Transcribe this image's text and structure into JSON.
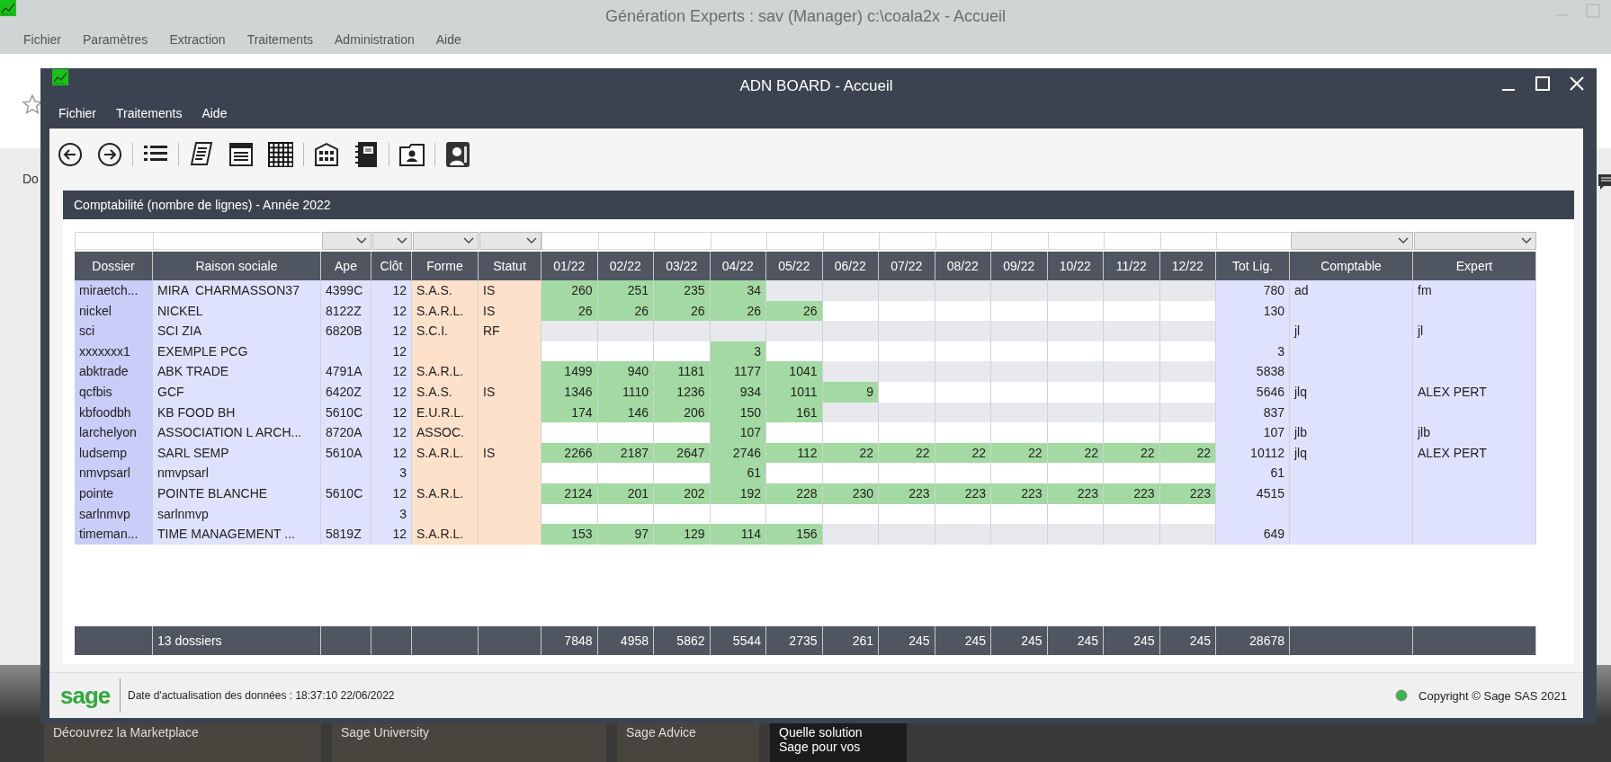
{
  "outer_window": {
    "title": "Génération Experts : sav (Manager) c:\\coala2x - Accueil",
    "menu": [
      "Fichier",
      "Paramètres",
      "Extraction",
      "Traitements",
      "Administration",
      "Aide"
    ],
    "side_label": "Do"
  },
  "window": {
    "title": "ADN BOARD - Accueil",
    "menu": [
      "Fichier",
      "Traitements",
      "Aide"
    ]
  },
  "panel": {
    "title": "Comptabilité (nombre de lignes) - Année 2022"
  },
  "table": {
    "columns": [
      {
        "label": "Dossier",
        "kind": "key",
        "filter": false
      },
      {
        "label": "Raison sociale",
        "kind": "text",
        "filter": false
      },
      {
        "label": "Ape",
        "kind": "text",
        "filter": true
      },
      {
        "label": "Clôt",
        "kind": "number",
        "filter": true
      },
      {
        "label": "Forme",
        "kind": "legal",
        "filter": true
      },
      {
        "label": "Statut",
        "kind": "legal",
        "filter": true
      },
      {
        "label": "01/22",
        "kind": "month",
        "filter": false
      },
      {
        "label": "02/22",
        "kind": "month",
        "filter": false
      },
      {
        "label": "03/22",
        "kind": "month",
        "filter": false
      },
      {
        "label": "04/22",
        "kind": "month",
        "filter": false
      },
      {
        "label": "05/22",
        "kind": "month",
        "filter": false
      },
      {
        "label": "06/22",
        "kind": "month",
        "filter": false
      },
      {
        "label": "07/22",
        "kind": "month",
        "filter": false
      },
      {
        "label": "08/22",
        "kind": "month",
        "filter": false
      },
      {
        "label": "09/22",
        "kind": "month",
        "filter": false
      },
      {
        "label": "10/22",
        "kind": "month",
        "filter": false
      },
      {
        "label": "11/22",
        "kind": "month",
        "filter": false
      },
      {
        "label": "12/22",
        "kind": "month",
        "filter": false
      },
      {
        "label": "Tot Lig.",
        "kind": "total",
        "filter": false
      },
      {
        "label": "Comptable",
        "kind": "person",
        "filter": true
      },
      {
        "label": "Expert",
        "kind": "person",
        "filter": true
      }
    ],
    "rows": [
      {
        "cells": [
          "miraetch...",
          "MIRA  CHARMASSON37",
          "4399C",
          "12",
          "S.A.S.",
          "IS",
          "260",
          "251",
          "235",
          "34",
          null,
          null,
          null,
          null,
          null,
          null,
          null,
          null,
          "780",
          "ad",
          "fm"
        ]
      },
      {
        "cells": [
          "nickel",
          "NICKEL",
          "8122Z",
          "12",
          "S.A.R.L.",
          "IS",
          "26",
          "26",
          "26",
          "26",
          "26",
          null,
          null,
          null,
          null,
          null,
          null,
          null,
          "130",
          null,
          null
        ]
      },
      {
        "cells": [
          "sci",
          "SCI ZIA",
          "6820B",
          "12",
          "S.C.I.",
          "RF",
          null,
          null,
          null,
          null,
          null,
          null,
          null,
          null,
          null,
          null,
          null,
          null,
          null,
          "jl",
          "jl"
        ]
      },
      {
        "cells": [
          "xxxxxxx1",
          "EXEMPLE PCG",
          null,
          "12",
          null,
          null,
          null,
          null,
          null,
          "3",
          null,
          null,
          null,
          null,
          null,
          null,
          null,
          null,
          "3",
          null,
          null
        ]
      },
      {
        "cells": [
          "abktrade",
          "ABK TRADE",
          "4791A",
          "12",
          "S.A.R.L.",
          null,
          "1499",
          "940",
          "1181",
          "1177",
          "1041",
          null,
          null,
          null,
          null,
          null,
          null,
          null,
          "5838",
          null,
          null
        ]
      },
      {
        "cells": [
          "qcfbis",
          "GCF",
          "6420Z",
          "12",
          "S.A.S.",
          "IS",
          "1346",
          "1110",
          "1236",
          "934",
          "1011",
          "9",
          null,
          null,
          null,
          null,
          null,
          null,
          "5646",
          "jlq",
          "ALEX PERT"
        ]
      },
      {
        "cells": [
          "kbfoodbh",
          "KB FOOD BH",
          "5610C",
          "12",
          "E.U.R.L.",
          null,
          "174",
          "146",
          "206",
          "150",
          "161",
          null,
          null,
          null,
          null,
          null,
          null,
          null,
          "837",
          null,
          null
        ]
      },
      {
        "cells": [
          "larchelyon",
          "ASSOCIATION L ARCH...",
          "8720A",
          "12",
          "ASSOC.",
          null,
          null,
          null,
          null,
          "107",
          null,
          null,
          null,
          null,
          null,
          null,
          null,
          null,
          "107",
          "jlb",
          "jlb"
        ]
      },
      {
        "cells": [
          "ludsemp",
          "SARL SEMP",
          "5610A",
          "12",
          "S.A.R.L.",
          "IS",
          "2266",
          "2187",
          "2647",
          "2746",
          "112",
          "22",
          "22",
          "22",
          "22",
          "22",
          "22",
          "22",
          "10112",
          "jlq",
          "ALEX PERT"
        ]
      },
      {
        "cells": [
          "nmvpsarl",
          "nmvpsarl",
          null,
          "3",
          null,
          null,
          null,
          null,
          null,
          "61",
          null,
          null,
          null,
          null,
          null,
          null,
          null,
          null,
          "61",
          null,
          null
        ]
      },
      {
        "cells": [
          "pointe",
          "POINTE BLANCHE",
          "5610C",
          "12",
          "S.A.R.L.",
          null,
          "2124",
          "201",
          "202",
          "192",
          "228",
          "230",
          "223",
          "223",
          "223",
          "223",
          "223",
          "223",
          "4515",
          null,
          null
        ]
      },
      {
        "cells": [
          "sarlnmvp",
          "sarlnmvp",
          null,
          "3",
          null,
          null,
          null,
          null,
          null,
          null,
          null,
          null,
          null,
          null,
          null,
          null,
          null,
          null,
          null,
          null,
          null
        ]
      },
      {
        "cells": [
          "timeman...",
          "TIME MANAGEMENT ...",
          "5819Z",
          "12",
          "S.A.R.L.",
          null,
          "153",
          "97",
          "129",
          "114",
          "156",
          null,
          null,
          null,
          null,
          null,
          null,
          null,
          "649",
          null,
          null
        ]
      }
    ],
    "footer": {
      "cells": [
        null,
        "13 dossiers",
        null,
        null,
        null,
        null,
        "7848",
        "4958",
        "5862",
        "5544",
        "2735",
        "261",
        "245",
        "245",
        "245",
        "245",
        "245",
        "245",
        "28678",
        null,
        null
      ]
    }
  },
  "status_bar": {
    "logo": "sage",
    "updated": "Date d'actualisation des données : 18:37:10 22/06/2022",
    "copyright": "Copyright © Sage SAS 2021"
  },
  "promos": [
    {
      "lines": [
        "Découvrez la Marketplace"
      ]
    },
    {
      "lines": [
        "Sage University"
      ]
    },
    {
      "lines": [
        "Sage Advice"
      ]
    },
    {
      "lines": [
        "Quelle solution",
        "Sage pour vos"
      ]
    }
  ]
}
